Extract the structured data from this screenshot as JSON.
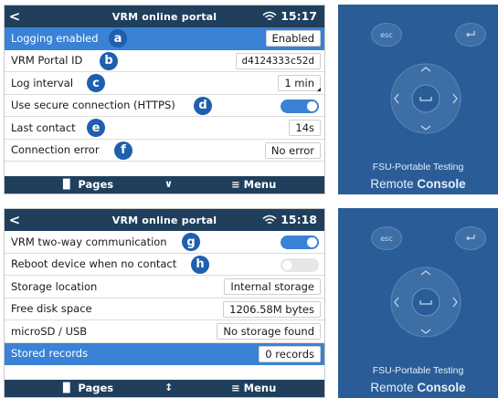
{
  "top": {
    "title": "VRM online portal",
    "time": "15:17",
    "rows": [
      {
        "label": "Logging enabled",
        "value": "Enabled",
        "marker": "a"
      },
      {
        "label": "VRM Portal ID",
        "value": "d4124333c52d",
        "marker": "b"
      },
      {
        "label": "Log interval",
        "value": "1 min",
        "marker": "c"
      },
      {
        "label": "Use secure connection (HTTPS)",
        "toggle": "on",
        "marker": "d"
      },
      {
        "label": "Last contact",
        "value": "14s",
        "marker": "e"
      },
      {
        "label": "Connection error",
        "value": "No error",
        "marker": "f"
      }
    ],
    "bottom": {
      "pages": "Pages",
      "menu": "Menu"
    }
  },
  "bottom": {
    "title": "VRM online portal",
    "time": "15:18",
    "rows": [
      {
        "label": "VRM two-way communication",
        "toggle": "on",
        "marker": "g"
      },
      {
        "label": "Reboot device when no contact",
        "toggle": "off",
        "marker": "h"
      },
      {
        "label": "Storage location",
        "value": "Internal storage"
      },
      {
        "label": "Free disk space",
        "value": "1206.58M bytes"
      },
      {
        "label": "microSD / USB",
        "value": "No storage found"
      },
      {
        "label": "Stored records",
        "value": "0 records"
      }
    ],
    "bottom": {
      "pages": "Pages",
      "menu": "Menu"
    }
  },
  "remote": {
    "esc_label": "esc",
    "device_name": "FSU-Portable Testing",
    "brand_plain": "Remote ",
    "brand_bold": "Console"
  },
  "icons": {
    "back": "chevron-left-icon",
    "wifi": "wifi-icon",
    "pages": "bar-chart-icon",
    "menu": "hamburger-icon",
    "nav_top": "chevron-down-icon",
    "nav_bottom": "chevron-up-down-icon"
  },
  "colors": {
    "title_bar": "#1f3f5d",
    "highlight": "#3a82d6",
    "marker": "#1e5fae",
    "remote_bg": "#2a5d98"
  }
}
